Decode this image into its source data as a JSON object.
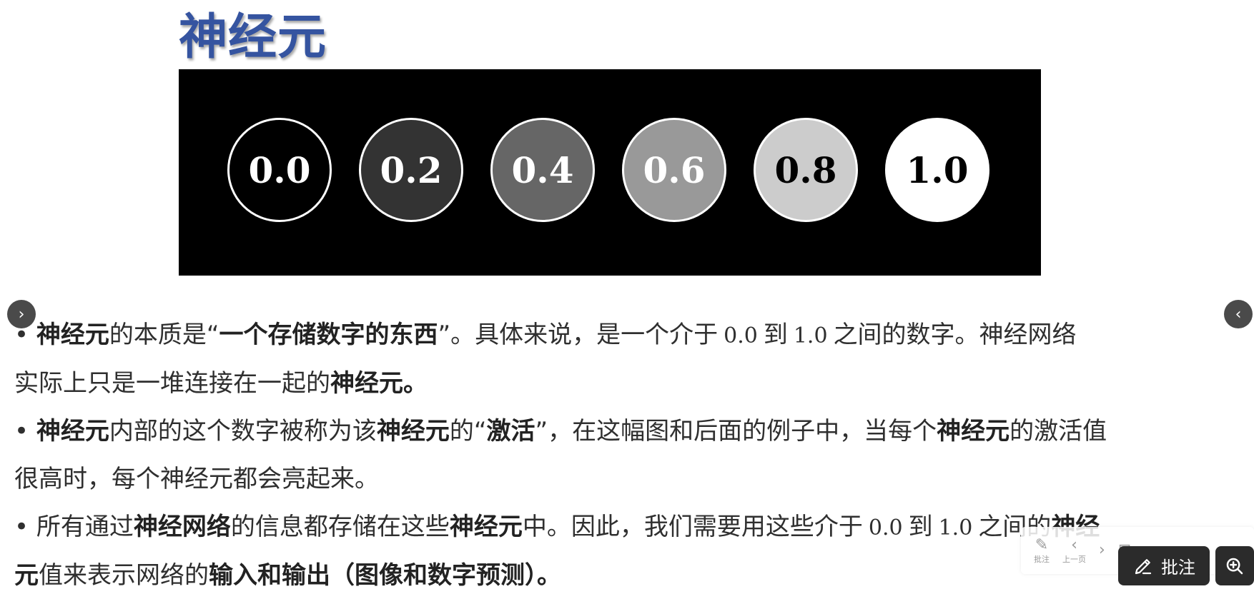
{
  "slide": {
    "title": "神经元",
    "neurons": [
      {
        "label": "0.0",
        "fill": "#000000",
        "text_color": "#ffffff"
      },
      {
        "label": "0.2",
        "fill": "#333333",
        "text_color": "#ffffff"
      },
      {
        "label": "0.4",
        "fill": "#666666",
        "text_color": "#ffffff"
      },
      {
        "label": "0.6",
        "fill": "#999999",
        "text_color": "#ffffff"
      },
      {
        "label": "0.8",
        "fill": "#cccccc",
        "text_color": "#000000"
      },
      {
        "label": "1.0",
        "fill": "#ffffff",
        "text_color": "#000000"
      }
    ],
    "paragraphs": [
      {
        "lines": [
          [
            {
              "text": "• ",
              "style": "normal"
            },
            {
              "text": "神经元",
              "style": "bold"
            },
            {
              "text": "的本质是“",
              "style": "normal"
            },
            {
              "text": "一个存储数字的东西",
              "style": "bold"
            },
            {
              "text": "”。具体来说，是一个介于",
              "style": "normal"
            },
            {
              "text": "0.0",
              "style": "num"
            },
            {
              "text": "到",
              "style": "normal"
            },
            {
              "text": "1.0",
              "style": "num"
            },
            {
              "text": "之间的数字。神经网络",
              "style": "normal"
            }
          ],
          [
            {
              "text": "实际上只是一堆连接在一起的",
              "style": "normal"
            },
            {
              "text": "神经元。",
              "style": "bold"
            }
          ]
        ]
      },
      {
        "lines": [
          [
            {
              "text": "• ",
              "style": "normal"
            },
            {
              "text": "神经元",
              "style": "bold"
            },
            {
              "text": "内部的这个数字被称为该",
              "style": "normal"
            },
            {
              "text": "神经元",
              "style": "bold"
            },
            {
              "text": "的“",
              "style": "normal"
            },
            {
              "text": "激活",
              "style": "bold"
            },
            {
              "text": "”，在这幅图和后面的例子中，当每个",
              "style": "normal"
            },
            {
              "text": "神经元",
              "style": "bold"
            },
            {
              "text": "的激活值",
              "style": "normal"
            }
          ],
          [
            {
              "text": "很高时，每个神经元都会亮起来。",
              "style": "normal"
            }
          ]
        ]
      },
      {
        "lines": [
          [
            {
              "text": "• 所有通过",
              "style": "normal"
            },
            {
              "text": "神经网络",
              "style": "bold"
            },
            {
              "text": "的信息都存储在这些",
              "style": "normal"
            },
            {
              "text": "神经元",
              "style": "bold"
            },
            {
              "text": "中。因此，我们需要用这些介于",
              "style": "normal"
            },
            {
              "text": "0.0",
              "style": "num"
            },
            {
              "text": "到",
              "style": "normal"
            },
            {
              "text": "1.0",
              "style": "num"
            },
            {
              "text": "之间的",
              "style": "normal"
            },
            {
              "text": "神经",
              "style": "bold"
            }
          ],
          [
            {
              "text": "元",
              "style": "bold"
            },
            {
              "text": "值来表示网络的",
              "style": "normal"
            },
            {
              "text": "输入和输出",
              "style": "bold"
            },
            {
              "text": "（图像和数字预测）。",
              "style": "bold"
            }
          ]
        ]
      }
    ]
  },
  "viewer": {
    "prev_icon": "chevron-right-icon",
    "next_icon": "chevron-left-icon",
    "ghost_toolbar": [
      {
        "icon": "pen-icon",
        "label": "批注"
      },
      {
        "icon": "prev-page-icon",
        "label": "上一页"
      },
      {
        "icon": "next-page-icon",
        "label": ""
      },
      {
        "icon": "exit-icon",
        "label": ""
      }
    ],
    "annotate_label": "批注",
    "zoom_icon": "zoom-in-icon"
  }
}
